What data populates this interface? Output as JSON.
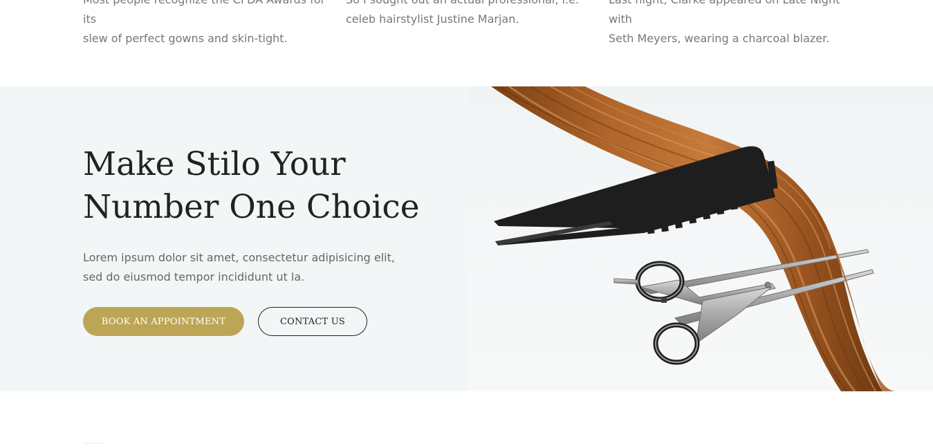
{
  "excerpts": [
    {
      "line1": "Most people recognize the CFDA Awards for its",
      "line2": "slew of perfect gowns and skin-tight."
    },
    {
      "line1": "So I sought out an actual professional, i.e.",
      "line2": "celeb hairstylist Justine Marjan."
    },
    {
      "line1": "Last night, Clarke appeared on Late Night with",
      "line2": "Seth Meyers, wearing a charcoal blazer."
    }
  ],
  "cta": {
    "title_line1": "Make Stilo Your",
    "title_line2": "Number One Choice",
    "text_line1": "Lorem ipsum dolor sit amet, consectetur adipisicing elit,",
    "text_line2": "sed do eiusmod tempor incididunt ut la.",
    "primary_button": "BOOK AN APPOINTMENT",
    "secondary_button": "CONTACT US"
  },
  "colors": {
    "accent": "#bda556",
    "section_bg": "#f2f6f7",
    "heading": "#222222",
    "body_text": "#777777"
  },
  "image": {
    "subject": "hair-comb-scissors-photo"
  }
}
